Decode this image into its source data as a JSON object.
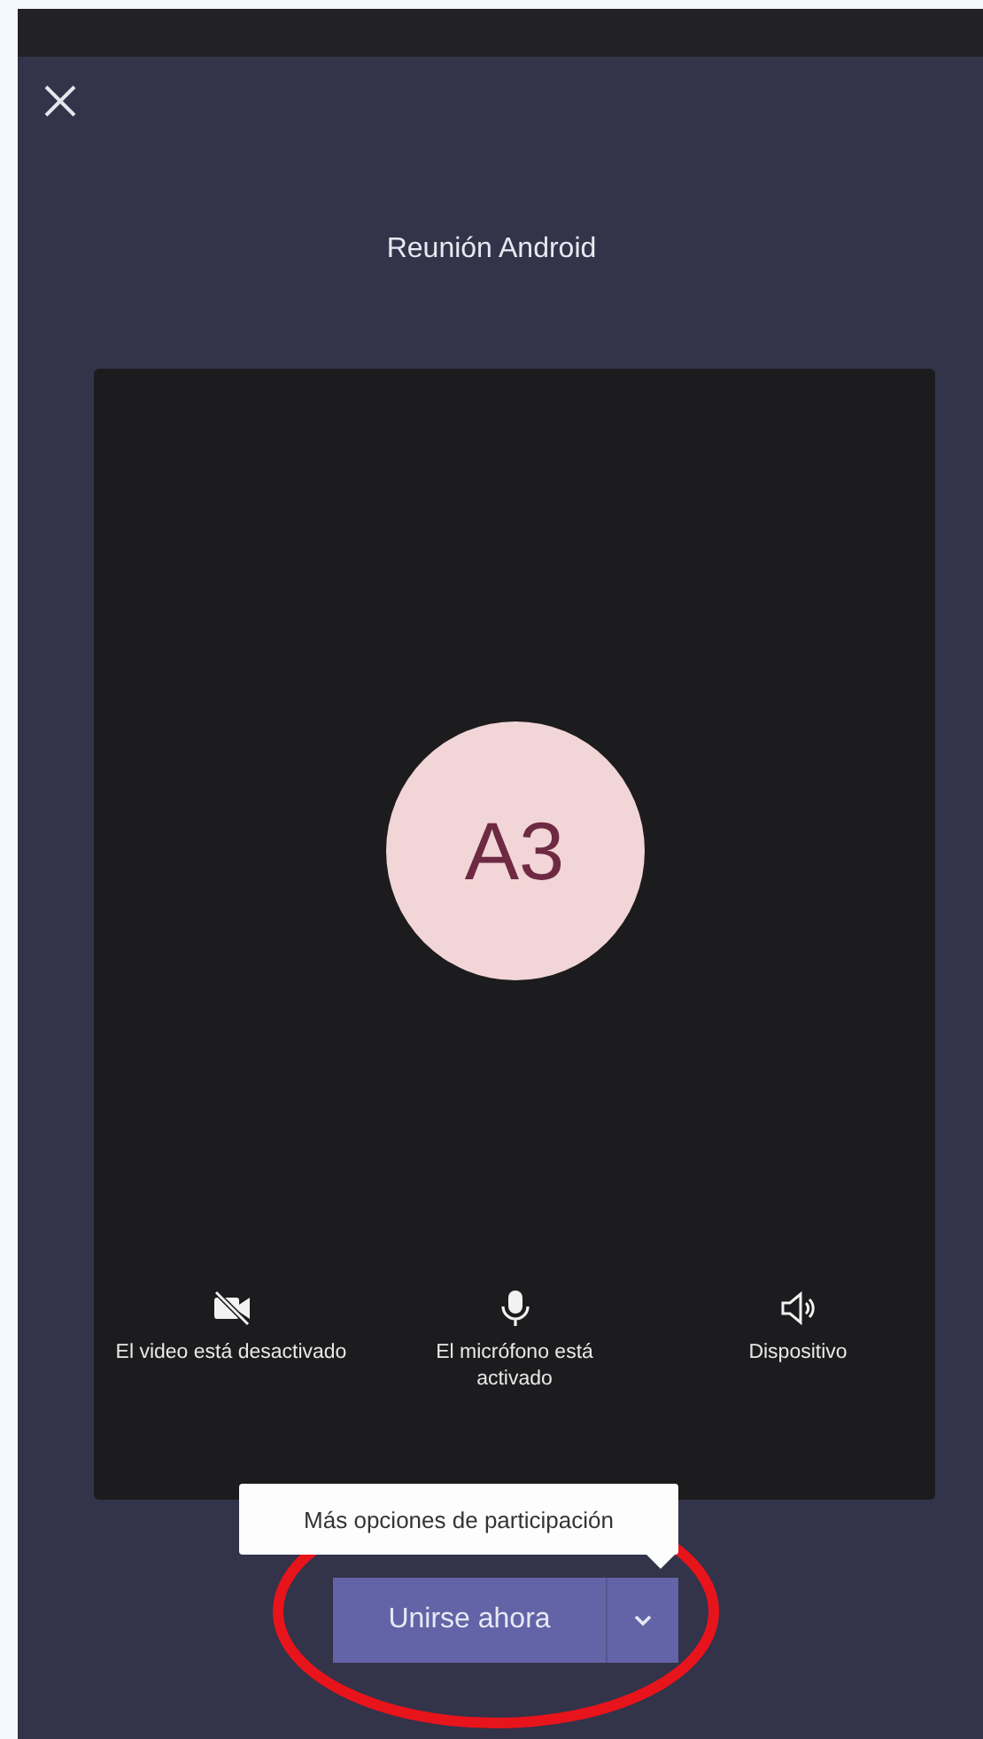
{
  "meeting": {
    "title": "Reunión Android",
    "avatar_initials": "A3"
  },
  "controls": [
    {
      "kind": "video",
      "on": false,
      "label": "El video está desactivado"
    },
    {
      "kind": "mic",
      "on": true,
      "label": "El micrófono está activado"
    },
    {
      "kind": "speaker",
      "label": "Dispositivo"
    }
  ],
  "tooltip": "Más opciones de participación",
  "join_button": "Unirse ahora",
  "annotation": {
    "kind": "ellipse",
    "color": "#e8141b"
  }
}
